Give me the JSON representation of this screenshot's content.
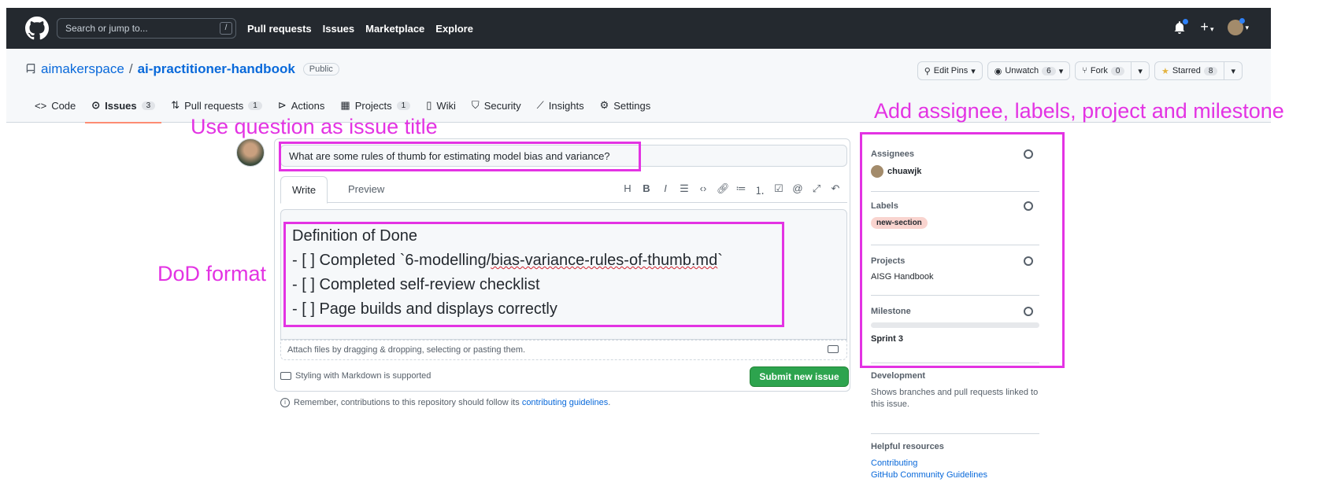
{
  "topbar": {
    "search_placeholder": "Search or jump to...",
    "search_shortcut": "/",
    "nav": [
      "Pull requests",
      "Issues",
      "Marketplace",
      "Explore"
    ]
  },
  "repo": {
    "owner": "aimakerspace",
    "separator": "/",
    "name": "ai-practitioner-handbook",
    "visibility": "Public",
    "actions": {
      "edit_pins": "Edit Pins",
      "unwatch": "Unwatch",
      "unwatch_count": "6",
      "fork": "Fork",
      "fork_count": "0",
      "starred": "Starred",
      "starred_count": "8"
    },
    "tabs": [
      {
        "label": "Code",
        "count": ""
      },
      {
        "label": "Issues",
        "count": "3"
      },
      {
        "label": "Pull requests",
        "count": "1"
      },
      {
        "label": "Actions",
        "count": ""
      },
      {
        "label": "Projects",
        "count": "1"
      },
      {
        "label": "Wiki",
        "count": ""
      },
      {
        "label": "Security",
        "count": ""
      },
      {
        "label": "Insights",
        "count": ""
      },
      {
        "label": "Settings",
        "count": ""
      }
    ]
  },
  "form": {
    "title_value": "What are some rules of thumb for estimating model bias and variance?",
    "tab_write": "Write",
    "tab_preview": "Preview",
    "body_lines": [
      "Definition of Done",
      "- [ ] Completed `6-modelling/",
      "bias-variance-rules-of-thumb.md",
      "`",
      "- [ ] Completed self-review checklist",
      "- [ ] Page builds and displays correctly"
    ],
    "attach_text": "Attach files by dragging & dropping, selecting or pasting them.",
    "markdown_note": "Styling with Markdown is supported",
    "submit_label": "Submit new issue",
    "remember_prefix": "Remember, contributions to this repository should follow its ",
    "remember_link": "contributing guidelines",
    "remember_suffix": "."
  },
  "sidebar": {
    "assignees_label": "Assignees",
    "assignee": "chuawjk",
    "labels_label": "Labels",
    "label": "new-section",
    "projects_label": "Projects",
    "project": "AISG Handbook",
    "milestone_label": "Milestone",
    "milestone": "Sprint 3",
    "development_label": "Development",
    "development_desc": "Shows branches and pull requests linked to this issue.",
    "helpful_label": "Helpful resources",
    "link_contributing": "Contributing",
    "link_guidelines": "GitHub Community Guidelines"
  },
  "annotations": {
    "title_note": "Use question as issue title",
    "dod_note": "DoD format",
    "sidebar_note": "Add assignee, labels, project and milestone"
  },
  "colors": {
    "annotation": "#e333e3",
    "submit": "#2da44e",
    "header": "#24292f",
    "link": "#0969da"
  }
}
